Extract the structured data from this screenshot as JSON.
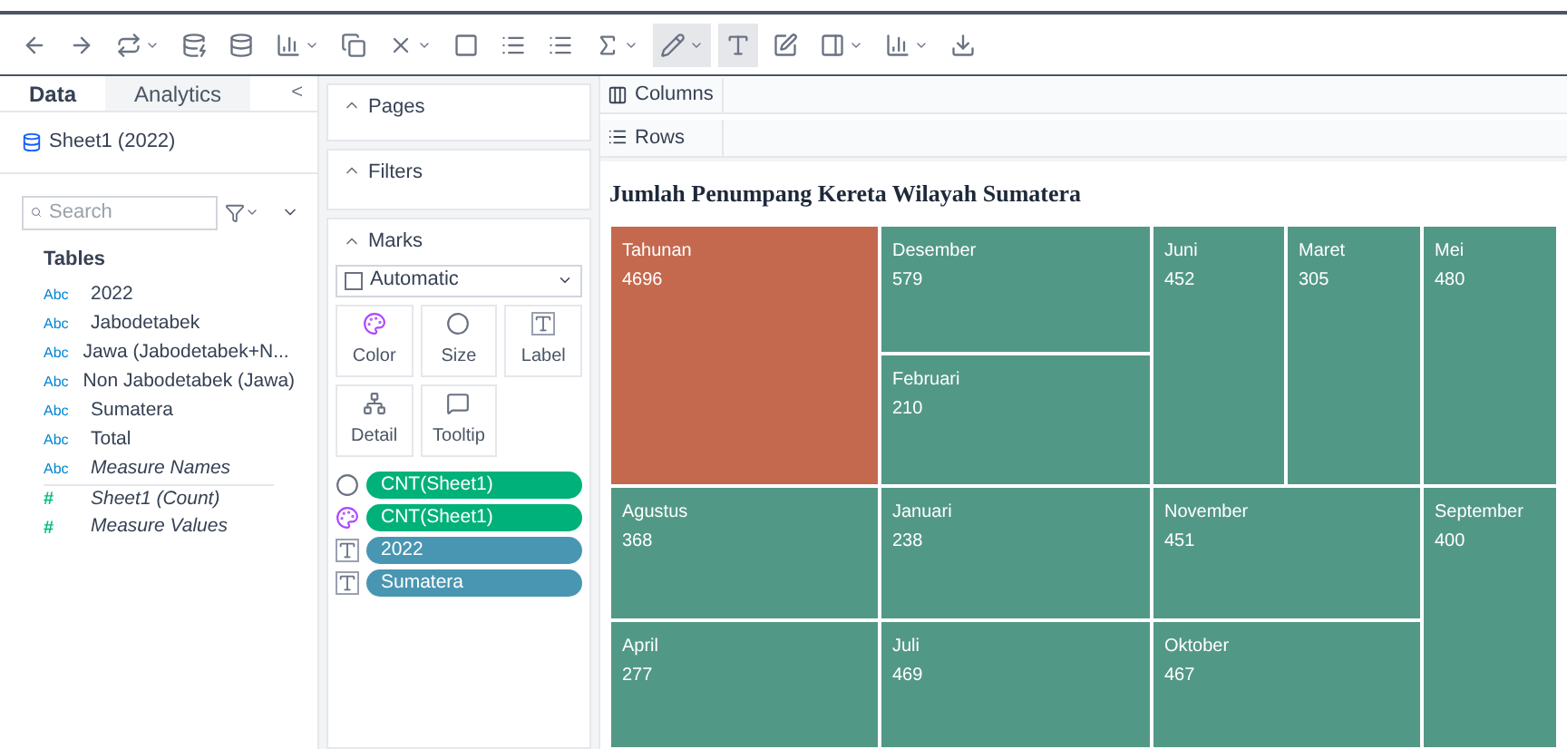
{
  "sidebar": {
    "tabs": [
      {
        "label": "Data",
        "selected": true
      },
      {
        "label": "Analytics",
        "selected": false
      }
    ],
    "collapse": "<",
    "datasource": "Sheet1 (2022)",
    "search": {
      "placeholder": "Search"
    },
    "tables_heading": "Tables",
    "fields": [
      {
        "kind": "dimension",
        "type": "Abc",
        "name": "2022",
        "italic": false
      },
      {
        "kind": "dimension",
        "type": "Abc",
        "name": "Jabodetabek",
        "italic": false
      },
      {
        "kind": "dimension",
        "type": "Abc",
        "name": "Jawa (Jabodetabek+N...",
        "italic": false
      },
      {
        "kind": "dimension",
        "type": "Abc",
        "name": "Non Jabodetabek (Jawa)",
        "italic": false
      },
      {
        "kind": "dimension",
        "type": "Abc",
        "name": "Sumatera",
        "italic": false
      },
      {
        "kind": "dimension",
        "type": "Abc",
        "name": "Total",
        "italic": false
      },
      {
        "kind": "dimension",
        "type": "Abc",
        "name": "Measure Names",
        "italic": true
      },
      {
        "kind": "measure",
        "type": "#",
        "name": "Sheet1 (Count)",
        "italic": true
      },
      {
        "kind": "measure",
        "type": "#",
        "name": "Measure Values",
        "italic": true
      }
    ]
  },
  "cards": {
    "pages": "Pages",
    "filters": "Filters",
    "marks": {
      "title": "Marks",
      "mark_type": "Automatic",
      "buttons": [
        {
          "kind": "color",
          "label": "Color"
        },
        {
          "kind": "size",
          "label": "Size"
        },
        {
          "kind": "label",
          "label": "Label"
        },
        {
          "kind": "detail",
          "label": "Detail"
        },
        {
          "kind": "tooltip",
          "label": "Tooltip"
        }
      ],
      "pills": [
        {
          "kind": "size",
          "label": "CNT(Sheet1)",
          "color": "#00b179"
        },
        {
          "kind": "color",
          "label": "CNT(Sheet1)",
          "color": "#00b179"
        },
        {
          "kind": "label",
          "label": "2022",
          "color": "#4996b2"
        },
        {
          "kind": "label",
          "label": "Sumatera",
          "color": "#4996b2"
        }
      ]
    }
  },
  "shelves": {
    "columns": "Columns",
    "rows": "Rows"
  },
  "view": {
    "title": "Jumlah Penumpang Kereta Wilayah Sumatera",
    "tiles": [
      {
        "name": "Tahunan",
        "value": "4696",
        "color": "#c4694e"
      },
      {
        "name": "Desember",
        "value": "579",
        "color": "#529886"
      },
      {
        "name": "Februari",
        "value": "210",
        "color": "#529886"
      },
      {
        "name": "Juni",
        "value": "452",
        "color": "#529886"
      },
      {
        "name": "Maret",
        "value": "305",
        "color": "#529886"
      },
      {
        "name": "Mei",
        "value": "480",
        "color": "#529886"
      },
      {
        "name": "Agustus",
        "value": "368",
        "color": "#529886"
      },
      {
        "name": "Januari",
        "value": "238",
        "color": "#529886"
      },
      {
        "name": "November",
        "value": "451",
        "color": "#529886"
      },
      {
        "name": "September",
        "value": "400",
        "color": "#529886"
      },
      {
        "name": "April",
        "value": "277",
        "color": "#529886"
      },
      {
        "name": "Juli",
        "value": "469",
        "color": "#529886"
      },
      {
        "name": "Oktober",
        "value": "467",
        "color": "#529886"
      }
    ]
  }
}
